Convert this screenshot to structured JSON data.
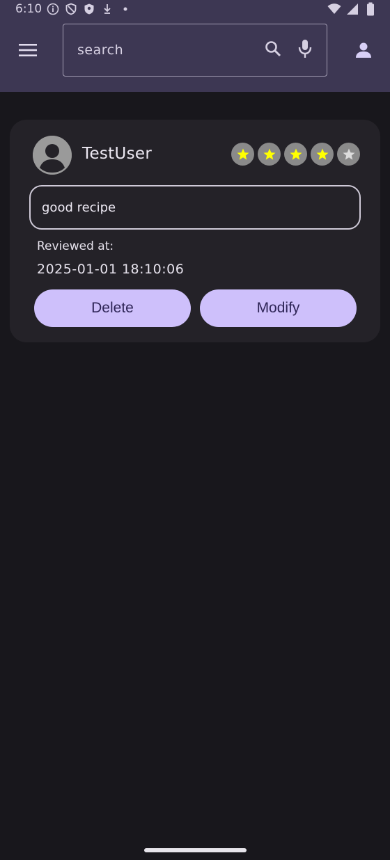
{
  "status_bar": {
    "time": "6:10",
    "icons_left": [
      "info-icon",
      "shield-outline-icon",
      "shield-filled-icon",
      "download-arrow-icon",
      "dot-icon"
    ],
    "icons_right": [
      "wifi-icon",
      "signal-icon",
      "battery-icon"
    ]
  },
  "app_bar": {
    "menu_icon": "hamburger-menu-icon",
    "search": {
      "placeholder": "search",
      "search_icon": "search-icon",
      "mic_icon": "microphone-icon"
    },
    "account_icon": "person-icon"
  },
  "review_card": {
    "username": "TestUser",
    "avatar_icon": "account-circle-icon",
    "rating": {
      "value": 4,
      "max": 5,
      "filled_color": "#ffff00",
      "empty_color": "#dcdcdc",
      "badge_color": "#8a8a8a"
    },
    "review_text": "good recipe",
    "reviewed_label": "Reviewed at:",
    "reviewed_at": "2025-01-01 18:10:06",
    "delete_label": "Delete",
    "modify_label": "Modify"
  },
  "colors": {
    "app_bar": "#3d3753",
    "background": "#18171c",
    "card": "#242228",
    "button": "#cec0fb",
    "button_text": "#2e2556"
  }
}
